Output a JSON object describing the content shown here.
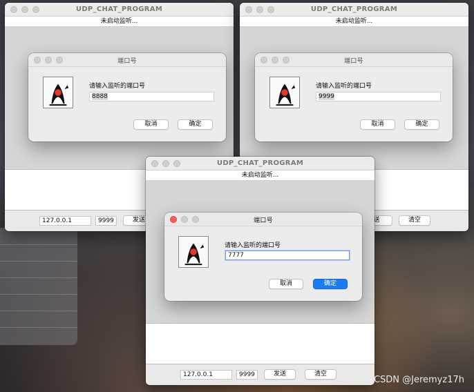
{
  "windows": {
    "left": {
      "title": "UDP_CHAT_PROGRAM",
      "status": "未启动监听...",
      "ip": "127.0.0.1",
      "port": "9999",
      "send_label": "发送"
    },
    "right": {
      "title": "UDP_CHAT_PROGRAM",
      "status": "未启动监听...",
      "send_label": "送",
      "clear_label": "清空"
    },
    "front": {
      "title": "UDP_CHAT_PROGRAM",
      "status": "未启动监听...",
      "ip": "127.0.0.1",
      "port": "9999",
      "send_label": "发送",
      "clear_label": "清空"
    }
  },
  "dialogs": {
    "left": {
      "title": "端口号",
      "prompt": "请输入监听的端口号",
      "value": "8888",
      "cancel_label": "取消",
      "ok_label": "确定"
    },
    "right": {
      "title": "端口号",
      "prompt": "请输入监听的端口号",
      "value": "9999",
      "cancel_label": "取消",
      "ok_label": "确定"
    },
    "front": {
      "title": "端口号",
      "prompt": "请输入监听的端口号",
      "value": "7777",
      "cancel_label": "取消",
      "ok_label": "确定"
    }
  },
  "watermark": "CSDN @Jeremyz17h",
  "icons": {
    "dialog_icon": "java-duke-icon"
  },
  "colors": {
    "primary_button": "#1a7df7",
    "close_dot": "#ff5f57"
  }
}
